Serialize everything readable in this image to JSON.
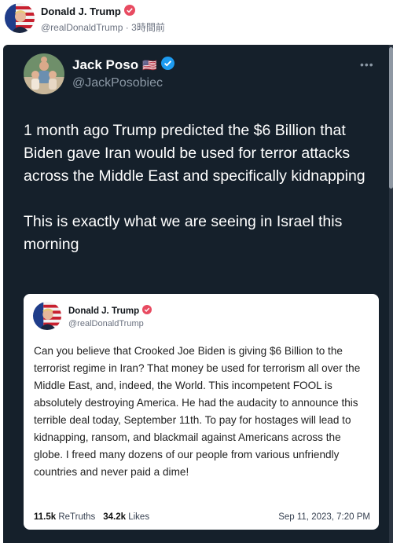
{
  "outer_post": {
    "author_name": "Donald J. Trump",
    "author_handle": "@realDonaldTrump",
    "separator": "·",
    "time_ago": "3時間前"
  },
  "tweet": {
    "author_name": "Jack Poso",
    "flag": "🇺🇸",
    "author_handle": "@JackPosobiec",
    "more": "•••",
    "paragraph_1": "1 month ago Trump predicted the $6 Billion that Biden gave Iran would be used for terror attacks across the Middle East and specifically kidnapping",
    "paragraph_2": "This is exactly what we are seeing in Israel this morning"
  },
  "quoted_post": {
    "author_name": "Donald J. Trump",
    "author_handle": "@realDonaldTrump",
    "text": "Can you believe that Crooked Joe Biden is giving $6 Billion to the terrorist regime in Iran? That money be used for terrorism all over the Middle East, and, indeed, the World. This incompetent FOOL is absolutely destroying America. He had the audacity to announce this terrible deal today, September 11th. To pay for hostages will lead to kidnapping, ransom, and blackmail against Americans across the globe. I freed many dozens of our people from various unfriendly countries and never paid a dime!",
    "retruths_count": "11.5k",
    "retruths_label": "ReTruths",
    "likes_count": "34.2k",
    "likes_label": "Likes",
    "date": "Sep 11, 2023, 7:20 PM"
  },
  "colors": {
    "dark_bg": "#15202b",
    "verified_blue": "#1d9bf0",
    "truth_badge": "#e84b61"
  },
  "icons": [
    "trump-avatar",
    "truth-verified-badge",
    "jack-avatar",
    "twitter-verified-icon",
    "more-icon"
  ]
}
